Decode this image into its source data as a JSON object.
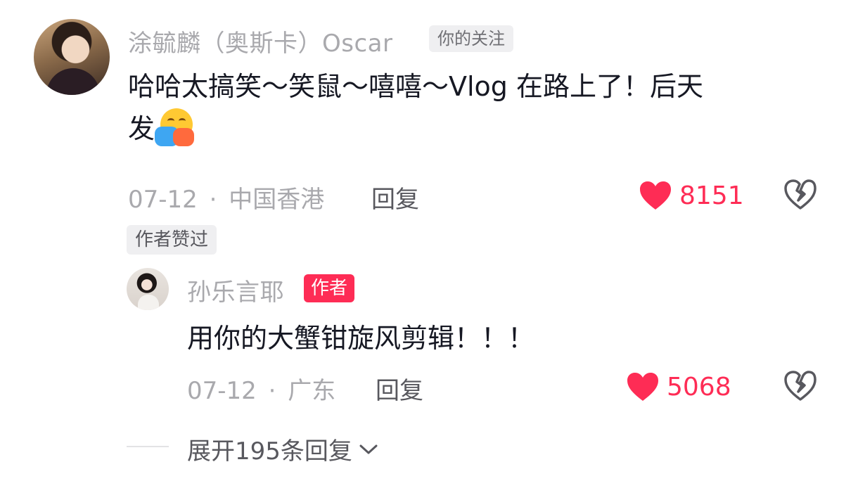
{
  "comment": {
    "username": "涂毓麟（奥斯卡）Oscar",
    "follow_tag": "你的关注",
    "text_line1": "哈哈太搞笑～笑鼠～嘻嘻～Vlog 在路上了！后天",
    "text_line2": "发",
    "emoji": "hugging-face-emoji",
    "date": "07-12",
    "location": "中国香港",
    "separator": "·",
    "reply_label": "回复",
    "like_count": "8151",
    "author_liked_badge": "作者赞过"
  },
  "reply": {
    "username": "孙乐言耶",
    "author_tag": "作者",
    "text": "用你的大蟹钳旋风剪辑！！！",
    "date": "07-12",
    "location": "广东",
    "separator": "·",
    "reply_label": "回复",
    "like_count": "5068"
  },
  "expand": {
    "label": "展开195条回复"
  },
  "colors": {
    "accent": "#fe2c55",
    "muted_text": "#a9a9ad",
    "primary_text": "#161823"
  },
  "icons": {
    "like": "heart-icon",
    "dislike": "broken-heart-icon",
    "expand": "chevron-down-icon"
  }
}
